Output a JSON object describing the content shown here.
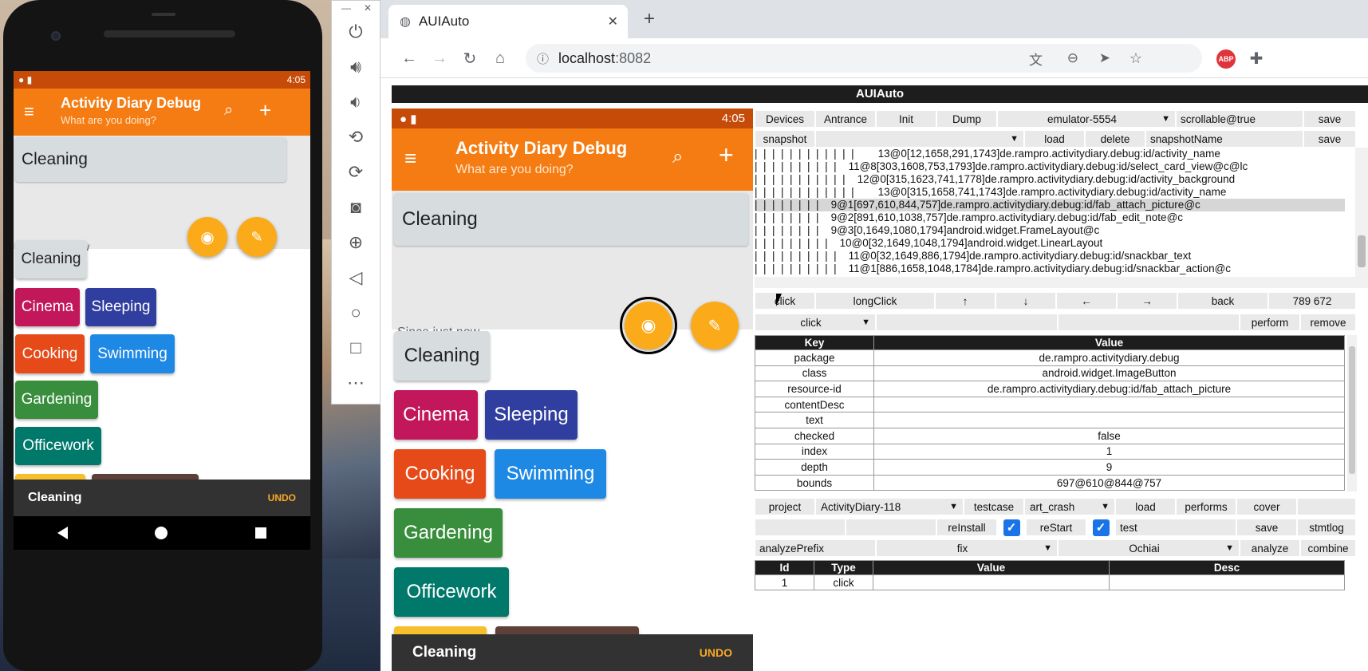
{
  "phone": {
    "status": {
      "time": "4:05"
    },
    "app_title": "Activity Diary Debug",
    "app_subtitle": "What are you doing?",
    "current_activity": "Cleaning",
    "since": "Since just now",
    "chips": [
      {
        "label": "Cleaning",
        "color": "#d7dcdf",
        "text_color": "#222"
      },
      {
        "label": "Cinema",
        "color": "#c2185b"
      },
      {
        "label": "Sleeping",
        "color": "#303f9f"
      },
      {
        "label": "Cooking",
        "color": "#e64a19"
      },
      {
        "label": "Swimming",
        "color": "#1e88e5"
      },
      {
        "label": "Gardening",
        "color": "#388e3c"
      },
      {
        "label": "Officework",
        "color": "#00796b"
      }
    ],
    "snackbar": {
      "text": "Cleaning",
      "action": "UNDO"
    },
    "colors": {
      "toolbar": "#f57c12",
      "statusbar": "#c64b08",
      "fab": "#fbab19"
    }
  },
  "emulator_side": {
    "close": "✕",
    "minimize": "—",
    "buttons": [
      "power-icon",
      "volume-up-icon",
      "volume-down-icon",
      "rotate-left-icon",
      "rotate-right-icon",
      "camera-icon",
      "zoom-icon",
      "back-icon",
      "home-icon",
      "overview-icon",
      "more-icon"
    ]
  },
  "browser": {
    "tab_title": "AUIAuto",
    "url_host": "localhost",
    "url_port": ":8082",
    "abp": "ABP"
  },
  "aui": {
    "title": "AUIAuto",
    "row1": {
      "devices": "Devices",
      "antrance": "Antrance",
      "init": "Init",
      "dump": "Dump",
      "device_select": "emulator-5554",
      "scrollable": "scrollable@true",
      "save": "save"
    },
    "row2": {
      "snapshot": "snapshot",
      "load": "load",
      "delete": "delete",
      "snapshot_name": "snapshotName",
      "save": "save"
    },
    "tree": [
      "|  |  |  |  |  |  |  |  |  |  |  |        13@0[12,1658,291,1743]de.rampro.activitydiary.debug:id/activity_name",
      "|  |  |  |  |  |  |  |  |  |    11@8[303,1608,753,1793]de.rampro.activitydiary.debug:id/select_card_view@c@lc",
      "|  |  |  |  |  |  |  |  |  |  |    12@0[315,1623,741,1778]de.rampro.activitydiary.debug:id/activity_background",
      "|  |  |  |  |  |  |  |  |  |  |  |        13@0[315,1658,741,1743]de.rampro.activitydiary.debug:id/activity_name",
      "|  |  |  |  |  |  |  |    9@1[697,610,844,757]de.rampro.activitydiary.debug:id/fab_attach_picture@c",
      "|  |  |  |  |  |  |  |    9@2[891,610,1038,757]de.rampro.activitydiary.debug:id/fab_edit_note@c",
      "|  |  |  |  |  |  |  |    9@3[0,1649,1080,1794]android.widget.FrameLayout@c",
      "|  |  |  |  |  |  |  |  |    10@0[32,1649,1048,1794]android.widget.LinearLayout",
      "|  |  |  |  |  |  |  |  |  |    11@0[32,1649,886,1794]de.rampro.activitydiary.debug:id/snackbar_text",
      "|  |  |  |  |  |  |  |  |  |    11@1[886,1658,1048,1784]de.rampro.activitydiary.debug:id/snackbar_action@c"
    ],
    "tree_highlight_index": 4,
    "actions": {
      "click": "click",
      "long_click": "longClick",
      "up": "↑",
      "down": "↓",
      "left": "←",
      "right": "→",
      "back": "back",
      "coords": "789 672"
    },
    "perform_row": {
      "action_select": "click",
      "perform": "perform",
      "remove": "remove"
    },
    "props_header": {
      "key": "Key",
      "value": "Value"
    },
    "props": [
      {
        "k": "package",
        "v": "de.rampro.activitydiary.debug"
      },
      {
        "k": "class",
        "v": "android.widget.ImageButton"
      },
      {
        "k": "resource-id",
        "v": "de.rampro.activitydiary.debug:id/fab_attach_picture"
      },
      {
        "k": "contentDesc",
        "v": ""
      },
      {
        "k": "text",
        "v": ""
      },
      {
        "k": "checked",
        "v": "false"
      },
      {
        "k": "index",
        "v": "1"
      },
      {
        "k": "depth",
        "v": "9"
      },
      {
        "k": "bounds",
        "v": "697@610@844@757"
      }
    ],
    "project_row": {
      "project": "project",
      "project_select": "ActivityDiary-118",
      "testcase": "testcase",
      "testcase_select": "art_crash",
      "load": "load",
      "performs": "performs",
      "cover": "cover"
    },
    "reinstall_row": {
      "reinstall": "reInstall",
      "restart": "reStart",
      "test": "test",
      "save": "save",
      "stmtlog": "stmtlog"
    },
    "analyze_row": {
      "prefix": "analyzePrefix",
      "fix": "fix",
      "ochiai": "Ochiai",
      "analyze": "analyze",
      "combine": "combine"
    },
    "steps_header": {
      "id": "Id",
      "type": "Type",
      "value": "Value",
      "desc": "Desc"
    },
    "steps": [
      {
        "id": "1",
        "type": "click",
        "value": "",
        "desc": ""
      }
    ]
  }
}
